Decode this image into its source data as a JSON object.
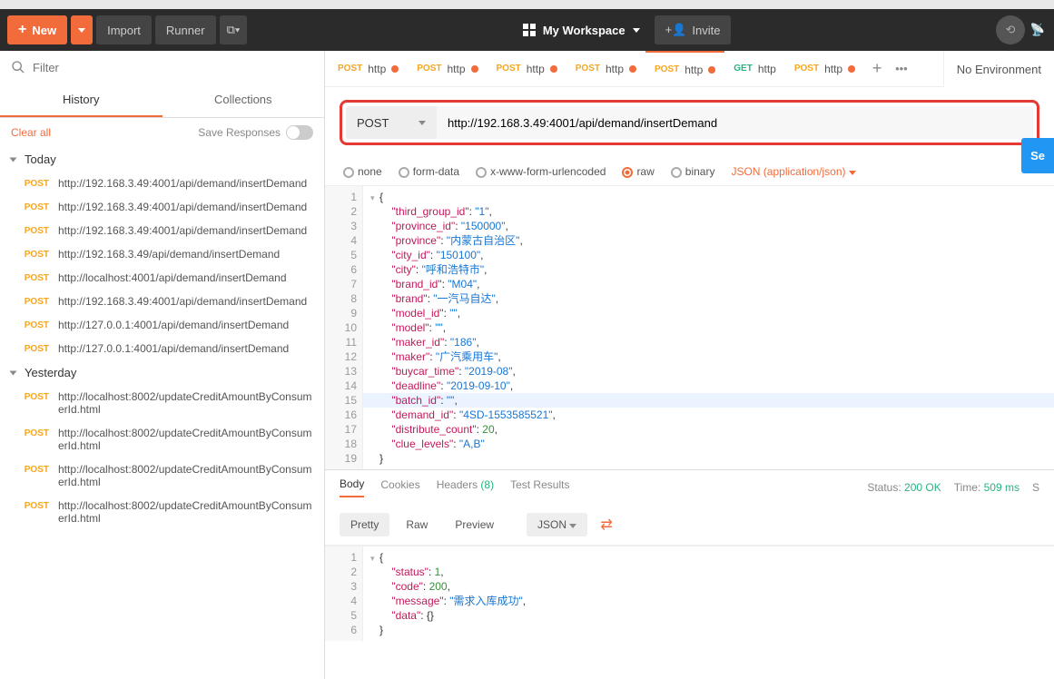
{
  "toolbar": {
    "new_label": "New",
    "import_label": "Import",
    "runner_label": "Runner",
    "workspace_label": "My Workspace",
    "invite_label": "Invite"
  },
  "environment": {
    "label": "No Environment"
  },
  "sidebar": {
    "filter_placeholder": "Filter",
    "tabs": {
      "history": "History",
      "collections": "Collections"
    },
    "clear_all": "Clear all",
    "save_responses": "Save Responses",
    "groups": [
      {
        "label": "Today",
        "items": [
          {
            "method": "POST",
            "url": "http://192.168.3.49:4001/api/demand/insertDemand"
          },
          {
            "method": "POST",
            "url": "http://192.168.3.49:4001/api/demand/insertDemand"
          },
          {
            "method": "POST",
            "url": "http://192.168.3.49:4001/api/demand/insertDemand"
          },
          {
            "method": "POST",
            "url": "http://192.168.3.49/api/demand/insertDemand"
          },
          {
            "method": "POST",
            "url": "http://localhost:4001/api/demand/insertDemand"
          },
          {
            "method": "POST",
            "url": "http://192.168.3.49:4001/api/demand/insertDemand"
          },
          {
            "method": "POST",
            "url": "http://127.0.0.1:4001/api/demand/insertDemand"
          },
          {
            "method": "POST",
            "url": "http://127.0.0.1:4001/api/demand/insertDemand"
          }
        ]
      },
      {
        "label": "Yesterday",
        "items": [
          {
            "method": "POST",
            "url": "http://localhost:8002/updateCreditAmountByConsumerId.html"
          },
          {
            "method": "POST",
            "url": "http://localhost:8002/updateCreditAmountByConsumerId.html"
          },
          {
            "method": "POST",
            "url": "http://localhost:8002/updateCreditAmountByConsumerId.html"
          },
          {
            "method": "POST",
            "url": "http://localhost:8002/updateCreditAmountByConsumerId.html"
          }
        ]
      }
    ]
  },
  "request_tabs": [
    {
      "method": "POST",
      "label": "http",
      "dirty": true
    },
    {
      "method": "POST",
      "label": "http",
      "dirty": true
    },
    {
      "method": "POST",
      "label": "http",
      "dirty": true
    },
    {
      "method": "POST",
      "label": "http",
      "dirty": true
    },
    {
      "method": "POST",
      "label": "http",
      "dirty": true,
      "active": true
    },
    {
      "method": "GET",
      "label": "http",
      "dirty": false
    },
    {
      "method": "POST",
      "label": "http",
      "dirty": true
    }
  ],
  "request": {
    "method": "POST",
    "url": "http://192.168.3.49:4001/api/demand/insertDemand",
    "send_label": "Se"
  },
  "body_types": {
    "none": "none",
    "form_data": "form-data",
    "urlencoded": "x-www-form-urlencoded",
    "raw": "raw",
    "binary": "binary",
    "content_type": "JSON (application/json)"
  },
  "request_body_lines": [
    {
      "n": 1,
      "indent": 0,
      "raw": "{",
      "fold": true
    },
    {
      "n": 2,
      "indent": 2,
      "key": "third_group_id",
      "val": "\"1\"",
      "t": "str"
    },
    {
      "n": 3,
      "indent": 2,
      "key": "province_id",
      "val": "\"150000\"",
      "t": "str"
    },
    {
      "n": 4,
      "indent": 2,
      "key": "province",
      "val": "\"内蒙古自治区\"",
      "t": "str"
    },
    {
      "n": 5,
      "indent": 2,
      "key": "city_id",
      "val": "\"150100\"",
      "t": "str"
    },
    {
      "n": 6,
      "indent": 2,
      "key": "city",
      "val": "\"呼和浩特市\"",
      "t": "str"
    },
    {
      "n": 7,
      "indent": 2,
      "key": "brand_id",
      "val": "\"M04\"",
      "t": "str"
    },
    {
      "n": 8,
      "indent": 2,
      "key": "brand",
      "val": "\"一汽马自达\"",
      "t": "str"
    },
    {
      "n": 9,
      "indent": 2,
      "key": "model_id",
      "val": "\"\"",
      "t": "str"
    },
    {
      "n": 10,
      "indent": 2,
      "key": "model",
      "val": "\"\"",
      "t": "str"
    },
    {
      "n": 11,
      "indent": 2,
      "key": "maker_id",
      "val": "\"186\"",
      "t": "str"
    },
    {
      "n": 12,
      "indent": 2,
      "key": "maker",
      "val": "\"广汽乘用车\"",
      "t": "str"
    },
    {
      "n": 13,
      "indent": 2,
      "key": "buycar_time",
      "val": "\"2019-08\"",
      "t": "str"
    },
    {
      "n": 14,
      "indent": 2,
      "key": "deadline",
      "val": "\"2019-09-10\"",
      "t": "str"
    },
    {
      "n": 15,
      "indent": 2,
      "key": "batch_id",
      "val": "\"\"",
      "t": "str",
      "hl": true
    },
    {
      "n": 16,
      "indent": 2,
      "key": "demand_id",
      "val": "\"4SD-1553585521\"",
      "t": "str"
    },
    {
      "n": 17,
      "indent": 2,
      "key": "distribute_count",
      "val": "20",
      "t": "num"
    },
    {
      "n": 18,
      "indent": 2,
      "key": "clue_levels",
      "val": "\"A,B\"",
      "t": "str",
      "last": true
    },
    {
      "n": 19,
      "indent": 0,
      "raw": "}"
    }
  ],
  "response_tabs": {
    "body": "Body",
    "cookies": "Cookies",
    "headers": "Headers",
    "headers_count": "(8)",
    "test_results": "Test Results"
  },
  "response_meta": {
    "status_label": "Status:",
    "status_value": "200 OK",
    "time_label": "Time:",
    "time_value": "509 ms",
    "size_label": "S"
  },
  "response_toolbar": {
    "pretty": "Pretty",
    "raw": "Raw",
    "preview": "Preview",
    "format": "JSON"
  },
  "response_body_lines": [
    {
      "n": 1,
      "indent": 0,
      "raw": "{",
      "fold": true
    },
    {
      "n": 2,
      "indent": 2,
      "key": "status",
      "val": "1",
      "t": "num"
    },
    {
      "n": 3,
      "indent": 2,
      "key": "code",
      "val": "200",
      "t": "num"
    },
    {
      "n": 4,
      "indent": 2,
      "key": "message",
      "val": "\"需求入库成功\"",
      "t": "str"
    },
    {
      "n": 5,
      "indent": 2,
      "key": "data",
      "val": "{}",
      "t": "brace",
      "last": true
    },
    {
      "n": 6,
      "indent": 0,
      "raw": "}"
    }
  ]
}
